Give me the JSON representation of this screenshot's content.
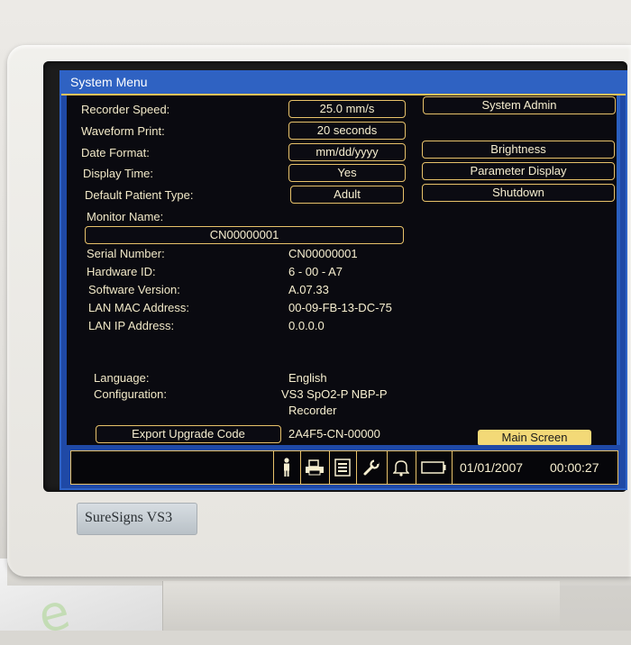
{
  "window": {
    "title": "System Menu"
  },
  "settings": {
    "recorder_speed": {
      "label": "Recorder Speed:",
      "value": "25.0 mm/s"
    },
    "waveform_print": {
      "label": "Waveform Print:",
      "value": "20 seconds"
    },
    "date_format": {
      "label": "Date Format:",
      "value": "mm/dd/yyyy"
    },
    "display_time": {
      "label": "Display Time:",
      "value": "Yes"
    },
    "default_patient_type": {
      "label": "Default Patient Type:",
      "value": "Adult"
    },
    "monitor_name": {
      "label": "Monitor Name:",
      "value": "CN00000001"
    }
  },
  "info": {
    "serial_number": {
      "label": "Serial Number:",
      "value": "CN00000001"
    },
    "hardware_id": {
      "label": "Hardware ID:",
      "value": "6 - 00 - A7"
    },
    "software_version": {
      "label": "Software Version:",
      "value": "A.07.33"
    },
    "lan_mac": {
      "label": "LAN MAC Address:",
      "value": "00-09-FB-13-DC-75"
    },
    "lan_ip": {
      "label": "LAN IP Address:",
      "value": "0.0.0.0"
    },
    "language": {
      "label": "Language:",
      "value": "English"
    },
    "configuration": {
      "label": "Configuration:",
      "value_line1": "VS3 SpO2-P NBP-P",
      "value_line2": "Recorder"
    },
    "upgrade_code": "2A4F5-CN-00000"
  },
  "buttons": {
    "system_admin": "System Admin",
    "brightness": "Brightness",
    "parameter_display": "Parameter Display",
    "shutdown": "Shutdown",
    "export_upgrade_code": "Export Upgrade Code",
    "main_screen": "Main Screen"
  },
  "status_bar": {
    "date": "01/01/2007",
    "time": "00:00:27",
    "icons": [
      "patient-icon",
      "printer-icon",
      "report-icon",
      "wrench-icon",
      "alarm-bell-icon",
      "battery-icon"
    ]
  },
  "device": {
    "brand": "SureSigns",
    "model": "VS3"
  },
  "colors": {
    "screen_blue": "#1f49a6",
    "accent_gold": "#e8c26a",
    "highlight_yellow": "#f3d977",
    "text_cream": "#f2e9c8"
  }
}
